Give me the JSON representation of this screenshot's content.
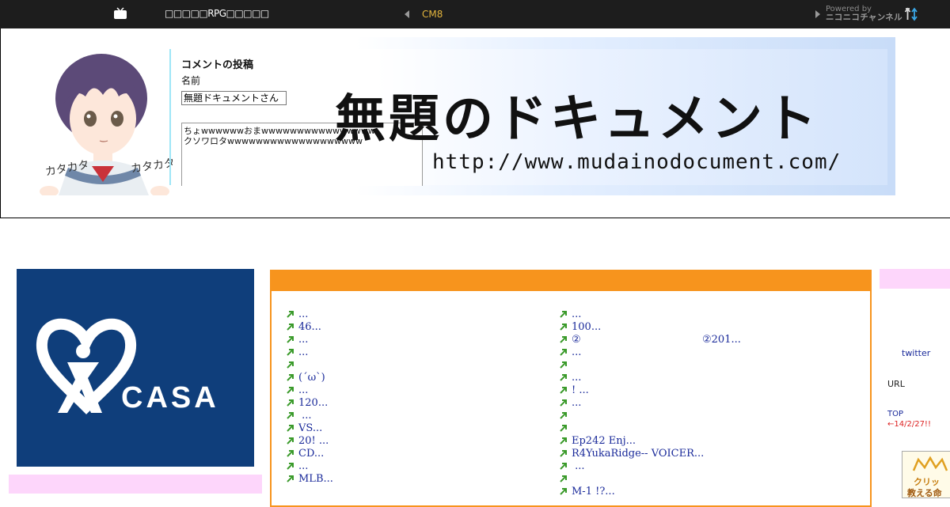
{
  "topbar": {
    "site_title": "□□□□□RPG□□□□□",
    "cm_label": "CM8",
    "powered_by": "Powered by",
    "channel": "ニコニコチャンネル"
  },
  "banner": {
    "form_title": "コメントの投稿",
    "name_label": "名前",
    "name_value": "無題ドキュメントさん",
    "comment_line1": "ちょwwwwwwおまwwwwwwwwwwwwwwww",
    "comment_line2": "クソワロタwwwwwwwwwwwwwwwwwww",
    "brand_title": "無題のドキュメント",
    "brand_url": "http://www.mudainodocument.com/",
    "mascot_text_left": "カタカタ",
    "mascot_text_right": "カタカタ"
  },
  "ad": {
    "brand": "CASA",
    "registered": "®"
  },
  "left_links": [
    {
      "text": "..."
    },
    {
      "text": "46..."
    },
    {
      "text": "..."
    },
    {
      "text": "..."
    },
    {
      "text": ""
    },
    {
      "text": "(´ω`)"
    },
    {
      "text": "..."
    },
    {
      "text": "120..."
    },
    {
      "text": " ..."
    },
    {
      "text": "VS..."
    },
    {
      "text": "20! ..."
    },
    {
      "text": "CD..."
    },
    {
      "text": "..."
    },
    {
      "text": "MLB..."
    }
  ],
  "right_links": [
    {
      "text": "...",
      "extra": ""
    },
    {
      "text": "100...",
      "extra": ""
    },
    {
      "text": "②",
      "extra": "②201..."
    },
    {
      "text": "...",
      "extra": ""
    },
    {
      "text": "",
      "extra": ""
    },
    {
      "text": "...",
      "extra": ""
    },
    {
      "text": "! ...",
      "extra": ""
    },
    {
      "text": "...",
      "extra": ""
    },
    {
      "text": "",
      "extra": ""
    },
    {
      "text": "",
      "extra": ""
    },
    {
      "text": "Ep242 Enj...",
      "extra": ""
    },
    {
      "text": "R4YukaRidge-- VOICER...",
      "extra": ""
    },
    {
      "text": " ...",
      "extra": ""
    },
    {
      "text": "",
      "extra": ""
    },
    {
      "text": "M-1  !?...",
      "extra": ""
    }
  ],
  "sidebar": {
    "twitter": "twitter",
    "url_label": "URL",
    "top_link": "TOP",
    "date_note": "←14/2/27!!",
    "click_ad_1": "クリッ",
    "click_ad_2": "教える命"
  },
  "colors": {
    "topbar_bg": "#1d1d1d",
    "cm_accent": "#e3b53d",
    "panel_orange": "#f7941d",
    "ad_navy": "#0f3e7b",
    "pink": "#fdd6fb",
    "link_blue": "#1a2a9a",
    "arrow_green": "#3a9a2a"
  },
  "icons": {
    "tv": "tv-icon",
    "prev": "chevron-left-icon",
    "next": "chevron-right-icon",
    "sort": "sort-arrows-icon",
    "link_arrow": "arrow-up-right-icon"
  }
}
